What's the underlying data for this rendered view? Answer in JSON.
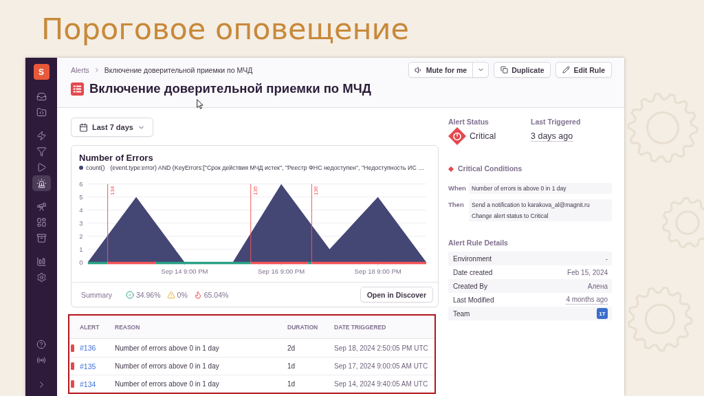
{
  "slide": {
    "title": "Пороговое оповещение"
  },
  "sidebar": {
    "avatar": "S",
    "items": [
      {
        "selected": false
      },
      {
        "selected": false
      },
      {
        "selected": false
      },
      {
        "selected": false
      },
      {
        "selected": false
      },
      {
        "selected": true
      },
      {
        "selected": false
      },
      {
        "selected": false
      },
      {
        "selected": false
      },
      {
        "selected": false
      },
      {
        "selected": false
      }
    ]
  },
  "header": {
    "breadcrumb": [
      "Alerts",
      "Включение доверительной приемки по МЧД"
    ],
    "title": "Включение доверительной приемки по МЧД",
    "buttons": [
      {
        "kind": "mute",
        "label": "Mute for me"
      },
      {
        "kind": "duplicate",
        "label": "Duplicate"
      },
      {
        "kind": "edit",
        "label": "Edit Rule"
      }
    ]
  },
  "time_range": {
    "label": "Last 7 days"
  },
  "chart_card": {
    "chart_data": {
      "type": "area",
      "title": "Number of Errors",
      "categories": [
        null,
        null,
        "Sep 14 9:00 PM",
        null,
        "Sep 16 9:00 PM",
        null,
        "Sep 18 9:00 PM",
        null
      ],
      "series": [
        {
          "name": "count()",
          "color": "#444674",
          "values": [
            0,
            5,
            0,
            0,
            6,
            1,
            5,
            0
          ]
        }
      ],
      "ylim": [
        0,
        6
      ],
      "yticks": [
        0,
        1,
        2,
        3,
        4,
        5,
        6
      ],
      "grid": true,
      "annotations": [
        "134",
        "135",
        "136"
      ]
    },
    "query": "(event.type:error) AND (KeyErrors:[\"Срок действия МЧД истек\", \"Реестр ФНС недоступен\", \"Недоступность ИС …",
    "summary_label": "Summary",
    "summary": [
      {
        "kind": "resolved",
        "value": "34.96%"
      },
      {
        "kind": "warning",
        "value": "0%"
      },
      {
        "kind": "critical",
        "value": "65.04%"
      }
    ],
    "action": "Open in Discover"
  },
  "alerts_table": {
    "highlighted": true,
    "columns": [
      "ALERT",
      "REASON",
      "DURATION",
      "DATE TRIGGERED"
    ],
    "rows": [
      {
        "color": "#e5484d",
        "alert": "#136",
        "reason": "Number of errors above 0 in 1 day",
        "duration": "2d",
        "date_triggered": "Sep 18, 2024 2:50:05 PM UTC"
      },
      {
        "color": "#e5484d",
        "alert": "#135",
        "reason": "Number of errors above 0 in 1 day",
        "duration": "1d",
        "date_triggered": "Sep 17, 2024 9:00:05 AM UTC"
      },
      {
        "color": "#e5484d",
        "alert": "#134",
        "reason": "Number of errors above 0 in 1 day",
        "duration": "1d",
        "date_triggered": "Sep 14, 2024 9:40:05 AM UTC"
      }
    ]
  },
  "alert_status": {
    "label": "Alert Status",
    "value": "Critical",
    "kind": "critical"
  },
  "last_triggered": {
    "label": "Last Triggered",
    "value": "3 days ago"
  },
  "critical_conditions": {
    "title": "Critical Conditions",
    "kind": "critical",
    "rows": [
      {
        "label": "When",
        "items": [
          "Number of errors is above 0 in 1 day"
        ]
      },
      {
        "label": "Then",
        "items": [
          "Send a notification to karakova_al@magnit.ru",
          "Change alert status to Critical"
        ]
      }
    ]
  },
  "rule_details": {
    "title": "Alert Rule Details",
    "rows": [
      {
        "kind": "text",
        "label": "Environment",
        "value": "-"
      },
      {
        "kind": "text",
        "label": "Date created",
        "value": "Feb 15, 2024"
      },
      {
        "kind": "text",
        "label": "Created By",
        "value": "Алена"
      },
      {
        "kind": "relative",
        "label": "Last Modified",
        "value": "4 months ago"
      },
      {
        "kind": "badge",
        "label": "Team",
        "value": "1T"
      }
    ]
  }
}
